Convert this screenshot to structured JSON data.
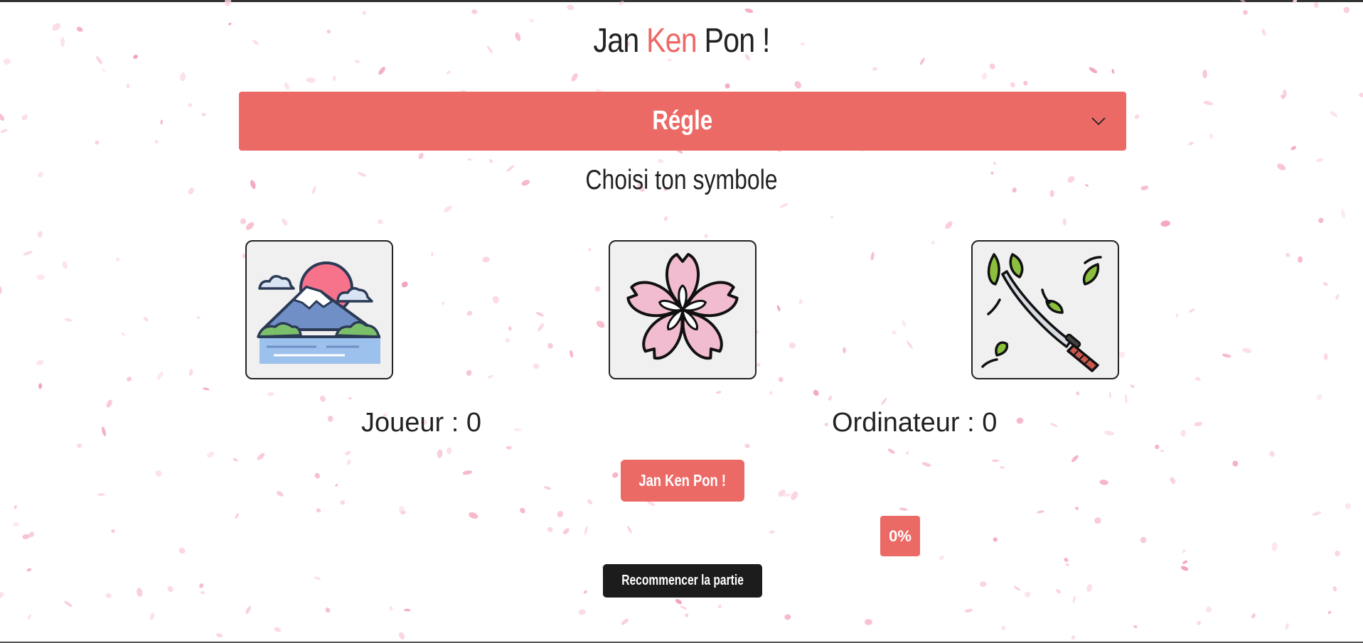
{
  "header": {
    "title_part1": "Jan ",
    "title_accent": "Ken",
    "title_part2": " Pon !"
  },
  "rules": {
    "label": "Régle",
    "icon": "chevron-down-icon"
  },
  "choose_prompt": "Choisi ton symbole",
  "choices": [
    {
      "id": "mountain",
      "icon": "mount-fuji-icon"
    },
    {
      "id": "flower",
      "icon": "cherry-blossom-icon"
    },
    {
      "id": "katana",
      "icon": "katana-icon"
    }
  ],
  "scores": {
    "player_label": "Joueur : 0",
    "computer_label": "Ordinateur : 0"
  },
  "buttons": {
    "play": "Jan Ken Pon !",
    "restart": "Recommencer la partie"
  },
  "progress": {
    "label": "0%",
    "value": 0
  },
  "colors": {
    "accent": "#ec6a66",
    "dark": "#1c1c1c",
    "petal": "#f4a7bb"
  }
}
